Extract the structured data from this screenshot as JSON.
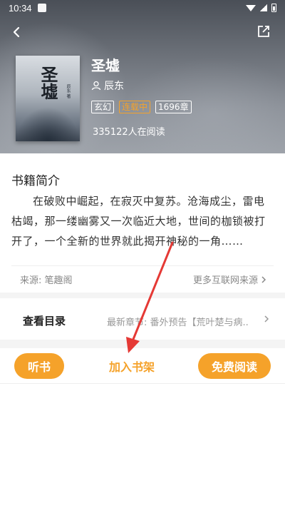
{
  "status_bar": {
    "time": "10:34"
  },
  "book": {
    "title": "圣墟",
    "author": "辰东",
    "tags": {
      "genre": "玄幻",
      "status": "连载中",
      "chapters": "1696章"
    },
    "readers": "335122人在阅读",
    "cover_title": "圣墟",
    "cover_subtitle": "辰东 著"
  },
  "intro": {
    "heading": "书籍简介",
    "text": "在破败中崛起，在寂灭中复苏。沧海成尘，雷电枯竭，那一缕幽雾又一次临近大地，世间的枷锁被打开了，一个全新的世界就此揭开神秘的一角……",
    "source_label": "来源: 笔趣阁",
    "more_sources": "更多互联网来源"
  },
  "toc": {
    "label": "查看目录",
    "latest": "最新章节: 番外预告【荒叶楚与病..."
  },
  "actions": {
    "listen": "听书",
    "add_shelf": "加入书架",
    "read_free": "免费阅读"
  },
  "colors": {
    "accent": "#f5a22a",
    "annotation": "#e53935"
  },
  "icons": {
    "back": "chevron-left-icon",
    "share": "share-icon",
    "author": "person-icon",
    "chevron": "chevron-right-icon"
  }
}
